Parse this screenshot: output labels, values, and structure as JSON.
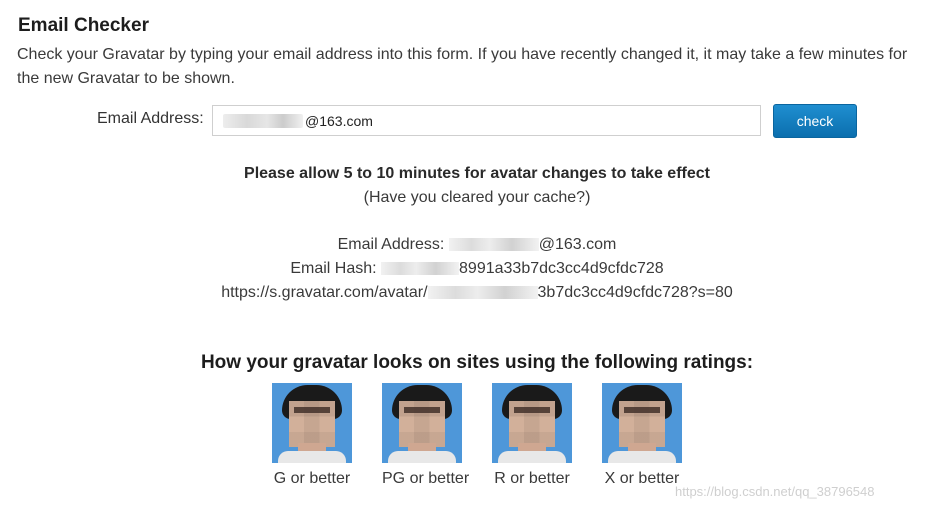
{
  "header": {
    "title": "Email Checker"
  },
  "intro": "Check your Gravatar by typing your email address into this form. If you have recently changed it, it may take a few minutes for the new Gravatar to be shown.",
  "form": {
    "label": "Email Address:",
    "value_suffix": "@163.com",
    "button_label": "check"
  },
  "notice": {
    "strong": "Please allow 5 to 10 minutes for avatar changes to take effect",
    "sub": "(Have you cleared your cache?)"
  },
  "info": {
    "email_prefix": "Email Address: ",
    "email_suffix": "@163.com",
    "hash_prefix": "Email Hash: ",
    "hash_suffix": "8991a33b7dc3cc4d9cfdc728",
    "url_prefix": "https://s.gravatar.com/avatar/",
    "url_suffix": "3b7dc3cc4d9cfdc728?s=80"
  },
  "ratings": {
    "heading": "How your gravatar looks on sites using the following ratings:",
    "items": [
      {
        "label": "G or better"
      },
      {
        "label": "PG or better"
      },
      {
        "label": "R or better"
      },
      {
        "label": "X or better"
      }
    ]
  },
  "watermark": "https://blog.csdn.net/qq_38796548",
  "colors": {
    "button": "#1278b8",
    "avatar_bg": "#4e97d9"
  }
}
